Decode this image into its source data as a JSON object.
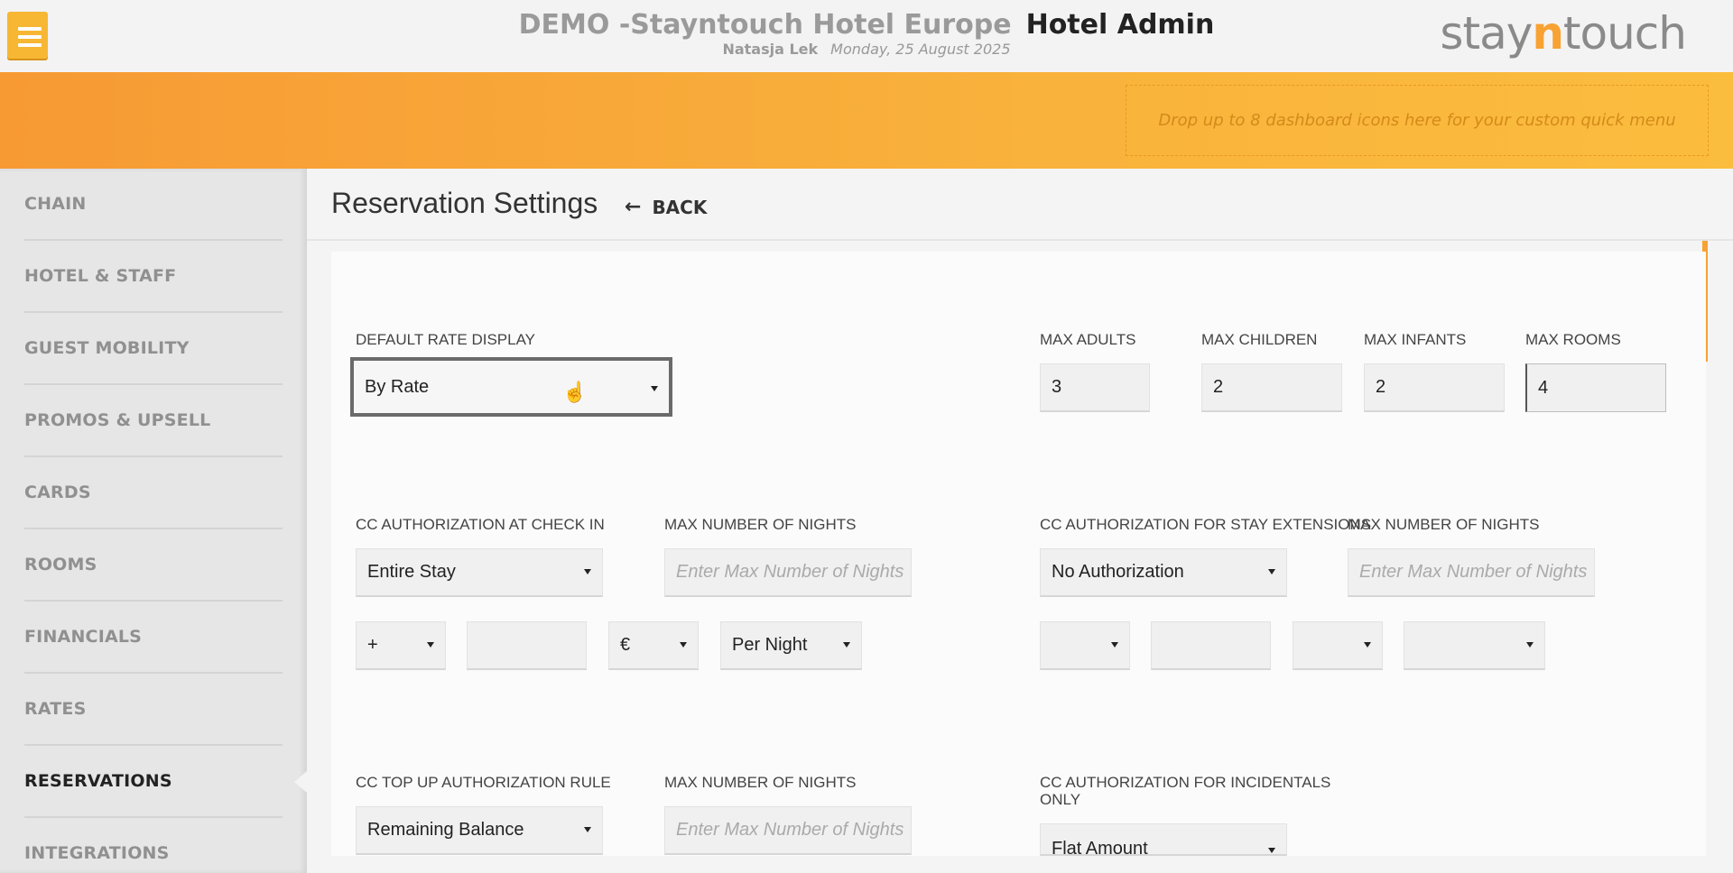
{
  "header": {
    "hotel_name": "DEMO -Stayntouch Hotel Europe",
    "app_name": "Hotel Admin",
    "user_name": "Natasja Lek",
    "date": "Monday, 25 August 2025",
    "logo_prefix": "stay",
    "logo_accent": "n",
    "logo_suffix": "touch"
  },
  "quick_menu": {
    "placeholder": "Drop up to 8 dashboard icons here for your custom quick menu"
  },
  "sidebar": {
    "items": [
      {
        "label": "CHAIN"
      },
      {
        "label": "HOTEL & STAFF"
      },
      {
        "label": "GUEST MOBILITY"
      },
      {
        "label": "PROMOS & UPSELL"
      },
      {
        "label": "CARDS"
      },
      {
        "label": "ROOMS"
      },
      {
        "label": "FINANCIALS"
      },
      {
        "label": "RATES"
      },
      {
        "label": "RESERVATIONS"
      },
      {
        "label": "INTEGRATIONS"
      }
    ],
    "active": "RESERVATIONS"
  },
  "page": {
    "title": "Reservation Settings",
    "back_label": "BACK"
  },
  "form": {
    "default_rate_display": {
      "label": "DEFAULT RATE DISPLAY",
      "value": "By Rate"
    },
    "max_adults": {
      "label": "MAX ADULTS",
      "value": "3"
    },
    "max_children": {
      "label": "MAX CHILDREN",
      "value": "2"
    },
    "max_infants": {
      "label": "MAX INFANTS",
      "value": "2"
    },
    "max_rooms": {
      "label": "MAX ROOMS",
      "value": "4"
    },
    "cc_auth_checkin": {
      "label": "CC AUTHORIZATION AT CHECK IN",
      "value": "Entire Stay"
    },
    "checkin_max_nights": {
      "label": "MAX NUMBER OF NIGHTS",
      "placeholder": "Enter Max Number of Nights"
    },
    "checkin_sign": {
      "value": "+"
    },
    "checkin_amount": {
      "value": ""
    },
    "checkin_currency": {
      "value": "€"
    },
    "checkin_per": {
      "value": "Per Night"
    },
    "cc_auth_extensions": {
      "label": "CC AUTHORIZATION FOR STAY EXTENSIONS",
      "value": "No Authorization"
    },
    "extensions_max_nights": {
      "label": "MAX NUMBER OF NIGHTS",
      "placeholder": "Enter Max Number of Nights"
    },
    "extensions_sign": {
      "value": ""
    },
    "extensions_amount": {
      "value": ""
    },
    "extensions_currency": {
      "value": ""
    },
    "extensions_per": {
      "value": ""
    },
    "cc_topup_rule": {
      "label": "CC TOP UP AUTHORIZATION RULE",
      "value": "Remaining Balance"
    },
    "topup_max_nights": {
      "label": "MAX NUMBER OF NIGHTS",
      "placeholder": "Enter Max Number of Nights"
    },
    "cc_auth_incidentals": {
      "label_line1": "CC AUTHORIZATION FOR INCIDENTALS",
      "label_line2": "ONLY",
      "value": "Flat Amount"
    }
  },
  "colors": {
    "accent": "#f7a233",
    "band_start": "#f79a34",
    "band_end": "#fbbd3e",
    "menu_button": "#f7b733"
  }
}
